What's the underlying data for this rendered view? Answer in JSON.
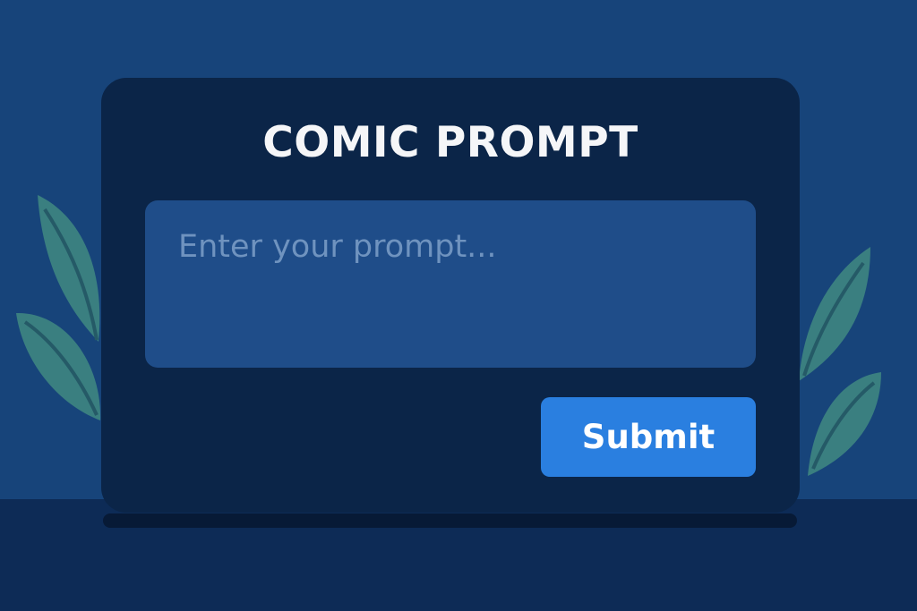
{
  "app": {
    "title": "COMIC PROMPT"
  },
  "prompt": {
    "placeholder": "Enter your prompt...",
    "value": ""
  },
  "actions": {
    "submit_label": "Submit"
  },
  "colors": {
    "background": "#17447a",
    "floor": "#0d2b56",
    "panel": "#0b2548",
    "input": "#1f4d89",
    "accent": "#2a7fe0",
    "leaf": "#3a7f80"
  },
  "icons": {
    "left_decoration": "leaf-plant-icon",
    "right_decoration": "leaf-plant-icon"
  }
}
